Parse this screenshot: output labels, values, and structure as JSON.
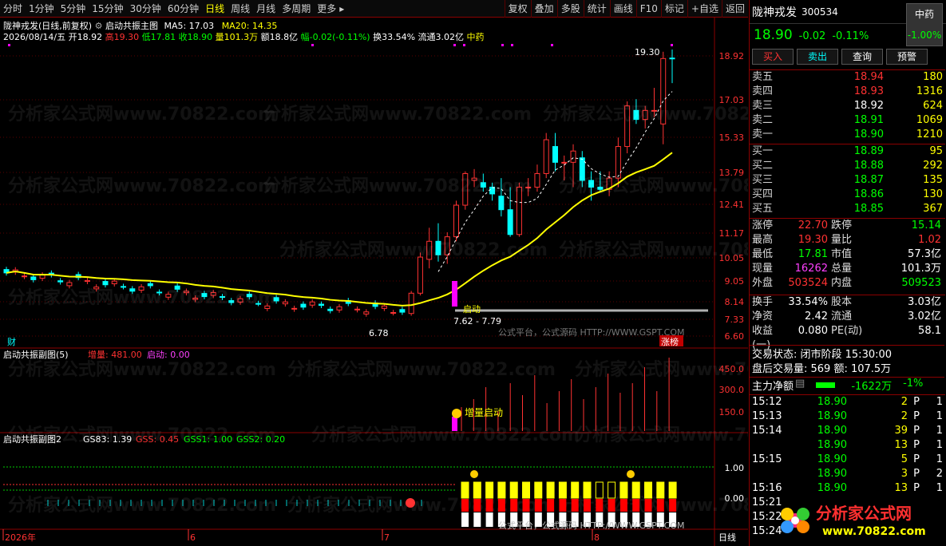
{
  "toolbar": {
    "left": [
      "分时",
      "1分钟",
      "5分钟",
      "15分钟",
      "30分钟",
      "60分钟",
      "日线",
      "周线",
      "月线",
      "多周期",
      "更多"
    ],
    "active": "日线",
    "right": [
      "复权",
      "叠加",
      "多股",
      "统计",
      "画线",
      "F10",
      "标记",
      "+自选",
      "返回"
    ]
  },
  "title_line": {
    "stock": "陇神戎发",
    "mode": "(日线,前复权)",
    "indicator": "启动共振主图",
    "ma5": "MA5: 17.03",
    "ma20": "MA20: 14.35"
  },
  "ohlc_line": {
    "date": "2026/08/14/五",
    "open": "开18.92",
    "high": "高19.30",
    "low": "低17.81",
    "close": "收18.90",
    "vol": "量101.3万",
    "amt": "额18.8亿",
    "amp": "幅-0.02(-0.11%)",
    "turn": "换33.54%",
    "float": "流通3.02亿",
    "sector": "中药"
  },
  "price_axis": [
    "18.92",
    "17.03",
    "15.33",
    "13.79",
    "12.41",
    "11.17",
    "10.05",
    "9.05",
    "8.14",
    "7.33",
    "6.60"
  ],
  "annotations": {
    "high": "19.30",
    "low": "6.78",
    "range": "7.62 - 7.79",
    "start": "启动",
    "cai": "财",
    "zhangbang": "涨榜",
    "watermark_gspt": "公式平台，公式源码 HTTP://WWW.GSPT.COM",
    "watermark_gspt2": "公式平台，公式源码 HTTP://WWW.GSPT.COM",
    "wm_site": "分析家公式网www.70822.com"
  },
  "sub1": {
    "title": "启动共振副图(5)",
    "v1": "增量: 481.00",
    "v2": "启动: 0.00",
    "axis": [
      "450.0",
      "300.0",
      "150.0"
    ],
    "label": "增量启动"
  },
  "sub2": {
    "title": "启动共振副图2",
    "v1": "GS83: 1.39",
    "v2": "GSS: 0.45",
    "v3": "GSS1: 1.00",
    "v4": "GSS2: 0.20",
    "axis": [
      "1.00",
      "0.00"
    ]
  },
  "xaxis": {
    "labels": [
      "2026年",
      "6",
      "7",
      "8"
    ],
    "period": "日线"
  },
  "panel": {
    "name": "陇神戎发",
    "code": "300534",
    "sector": "中药",
    "sector_pct": "-1.00%",
    "price": "18.90",
    "chg": "-0.02",
    "pct": "-0.11%",
    "buttons": [
      "买入",
      "卖出",
      "查询",
      "预警"
    ]
  },
  "asks": [
    [
      "卖五",
      "18.94",
      "180"
    ],
    [
      "卖四",
      "18.93",
      "1316"
    ],
    [
      "卖三",
      "18.92",
      "624"
    ],
    [
      "卖二",
      "18.91",
      "1069"
    ],
    [
      "卖一",
      "18.90",
      "1210"
    ]
  ],
  "bids": [
    [
      "买一",
      "18.89",
      "95"
    ],
    [
      "买二",
      "18.88",
      "292"
    ],
    [
      "买三",
      "18.87",
      "135"
    ],
    [
      "买四",
      "18.86",
      "130"
    ],
    [
      "买五",
      "18.85",
      "367"
    ]
  ],
  "stats": [
    [
      "涨停",
      "22.70",
      "跌停",
      "15.14"
    ],
    [
      "最高",
      "19.30",
      "量比",
      "1.02"
    ],
    [
      "最低",
      "17.81",
      "市值",
      "57.3亿"
    ],
    [
      "现量",
      "16262",
      "总量",
      "101.3万"
    ],
    [
      "外盘",
      "503524",
      "内盘",
      "509523"
    ]
  ],
  "stats2": [
    [
      "换手",
      "33.54%",
      "股本",
      "3.03亿"
    ],
    [
      "净资",
      "2.42",
      "流通",
      "3.02亿"
    ],
    [
      "收益(一)",
      "0.080",
      "PE(动)",
      "58.1"
    ]
  ],
  "status": {
    "line1": "交易状态: 闭市阶段 15:30:00",
    "line2": "盘后交易量: 569  额: 107.5万"
  },
  "flow": {
    "label": "主力净额",
    "value": "-1622万",
    "pct": "-1%"
  },
  "ticks": [
    [
      "15:12",
      "18.90",
      "2",
      "P",
      "1"
    ],
    [
      "15:13",
      "18.90",
      "2",
      "P",
      "1"
    ],
    [
      "15:14",
      "18.90",
      "39",
      "P",
      "1"
    ],
    [
      "",
      "18.90",
      "13",
      "P",
      "1"
    ],
    [
      "15:15",
      "18.90",
      "5",
      "P",
      "1"
    ],
    [
      "",
      "18.90",
      "3",
      "P",
      "2"
    ],
    [
      "15:16",
      "18.90",
      "13",
      "P",
      "1"
    ],
    [
      "15:21",
      "",
      "",
      "",
      ""
    ],
    [
      "15:22",
      "",
      "",
      "",
      ""
    ],
    [
      "15:24",
      "",
      "",
      "",
      ""
    ]
  ],
  "logo": {
    "text": "分析家公式网",
    "url": "www.70822.com"
  },
  "chart_data": {
    "type": "candlestick",
    "title": "陇神戎发(日线,前复权)",
    "ylim": [
      6.6,
      19.3
    ],
    "last_close": 18.9
  }
}
